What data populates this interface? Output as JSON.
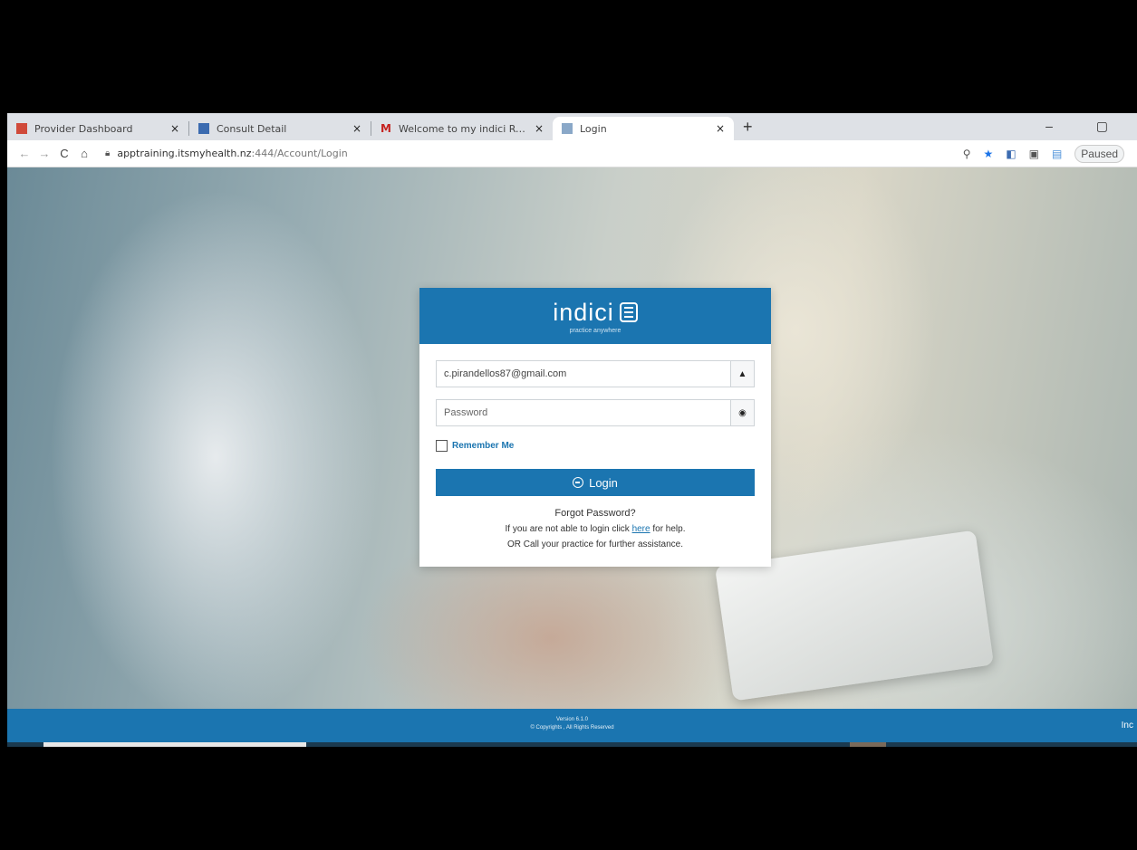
{
  "browser": {
    "tabs": [
      {
        "title": "Provider Dashboard",
        "favicon_color": "#d04a3a",
        "active": false
      },
      {
        "title": "Consult Detail",
        "favicon_color": "#3b6bb0",
        "active": false
      },
      {
        "title": "Welcome to my indici Registrati",
        "favicon_color": "#c5221f",
        "active": false
      },
      {
        "title": "Login",
        "favicon_color": "#8aa8c8",
        "active": true
      }
    ],
    "close_glyph": "×",
    "new_tab_glyph": "+",
    "url_host": "apptraining.itsmyhealth.nz",
    "url_path": ":444/Account/Login",
    "profile_status": "Paused"
  },
  "login": {
    "brand": "indici",
    "tagline": "practice anywhere",
    "email_value": "c.pirandellos87@gmail.com",
    "password_placeholder": "Password",
    "remember_label": "Remember Me",
    "login_label": "Login",
    "forgot_text": "Forgot Password?",
    "help_prefix": "If you are not able to login click ",
    "help_link": "here",
    "help_suffix": " for help.",
    "call_text": "OR Call your practice for further assistance."
  },
  "footer": {
    "version": "Version 6.1.0",
    "copyright": "© Copyrights , All Rights Reserved",
    "brand": "Inc"
  },
  "colors": {
    "brand_blue": "#1b75b0"
  }
}
